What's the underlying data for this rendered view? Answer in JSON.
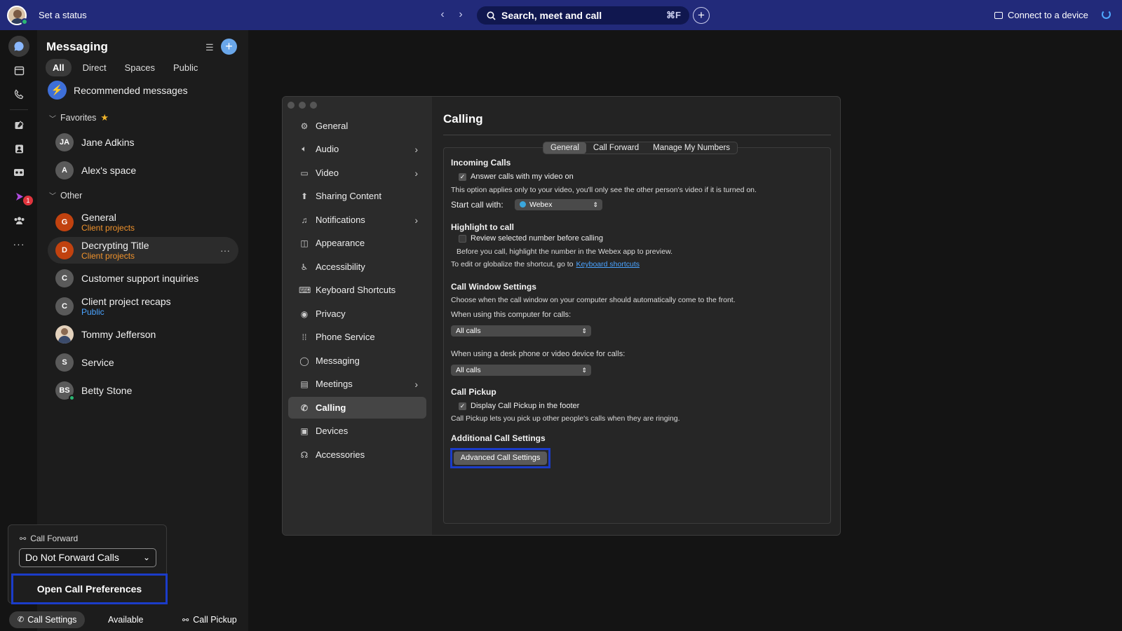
{
  "topbar": {
    "status": "Set a status",
    "search_placeholder": "Search, meet and call",
    "search_shortcut": "⌘F",
    "connect": "Connect to a device"
  },
  "rail": {
    "badge_count": "1"
  },
  "messaging": {
    "title": "Messaging",
    "tabs": [
      "All",
      "Direct",
      "Spaces",
      "Public"
    ],
    "recommended": "Recommended messages",
    "favorites_label": "Favorites",
    "other_label": "Other",
    "favorites": [
      {
        "initials": "JA",
        "name": "Jane Adkins"
      },
      {
        "initials": "A",
        "name": "Alex's space"
      }
    ],
    "other": [
      {
        "initials": "G",
        "name": "General",
        "sub": "Client projects"
      },
      {
        "initials": "D",
        "name": "Decrypting Title",
        "sub": "Client projects"
      },
      {
        "initials": "C",
        "name": "Customer support inquiries"
      },
      {
        "initials": "C",
        "name": "Client project recaps",
        "sub": "Public"
      },
      {
        "initials": "",
        "name": "Tommy Jefferson"
      },
      {
        "initials": "S",
        "name": "Service"
      },
      {
        "initials": "BS",
        "name": "Betty Stone"
      }
    ]
  },
  "call_forward_popup": {
    "label": "Call Forward",
    "selected": "Do Not Forward Calls",
    "open_prefs": "Open Call Preferences"
  },
  "footer": {
    "call_settings": "Call Settings",
    "available": "Available",
    "call_pickup": "Call Pickup"
  },
  "settings": {
    "sidebar": [
      {
        "label": "General",
        "icon": "gear-icon"
      },
      {
        "label": "Audio",
        "icon": "speaker-icon",
        "arrow": true
      },
      {
        "label": "Video",
        "icon": "video-icon",
        "arrow": true
      },
      {
        "label": "Sharing Content",
        "icon": "share-icon"
      },
      {
        "label": "Notifications",
        "icon": "bell-icon",
        "arrow": true
      },
      {
        "label": "Appearance",
        "icon": "appearance-icon"
      },
      {
        "label": "Accessibility",
        "icon": "accessibility-icon"
      },
      {
        "label": "Keyboard Shortcuts",
        "icon": "keyboard-icon"
      },
      {
        "label": "Privacy",
        "icon": "privacy-icon"
      },
      {
        "label": "Phone Service",
        "icon": "dialpad-icon"
      },
      {
        "label": "Messaging",
        "icon": "chat-icon"
      },
      {
        "label": "Meetings",
        "icon": "calendar-icon",
        "arrow": true
      },
      {
        "label": "Calling",
        "icon": "phone-icon",
        "active": true
      },
      {
        "label": "Devices",
        "icon": "devices-icon"
      },
      {
        "label": "Accessories",
        "icon": "headset-icon"
      }
    ],
    "title": "Calling",
    "subtabs": [
      "General",
      "Call Forward",
      "Manage My Numbers"
    ],
    "incoming": {
      "heading": "Incoming Calls",
      "answer_video": "Answer calls with my video on",
      "note": "This option applies only to your video, you'll only see the other person's video if it is turned on.",
      "start_label": "Start call with:",
      "start_value": "Webex"
    },
    "highlight": {
      "heading": "Highlight to call",
      "review": "Review selected number before calling",
      "note": "Before you call, highlight the number in the Webex app to preview.",
      "edit_text": "To edit or globalize the shortcut, go to",
      "link": "Keyboard shortcuts"
    },
    "window": {
      "heading": "Call Window Settings",
      "note": "Choose when the call window on your computer should automatically come to the front.",
      "computer_label": "When using this computer for calls:",
      "computer_value": "All calls",
      "desk_label": "When using a desk phone or video device for calls:",
      "desk_value": "All calls"
    },
    "pickup": {
      "heading": "Call Pickup",
      "display": "Display Call Pickup in the footer",
      "note": "Call Pickup lets you pick up other people's calls when they are ringing."
    },
    "additional": {
      "heading": "Additional Call Settings",
      "button": "Advanced Call Settings"
    }
  }
}
